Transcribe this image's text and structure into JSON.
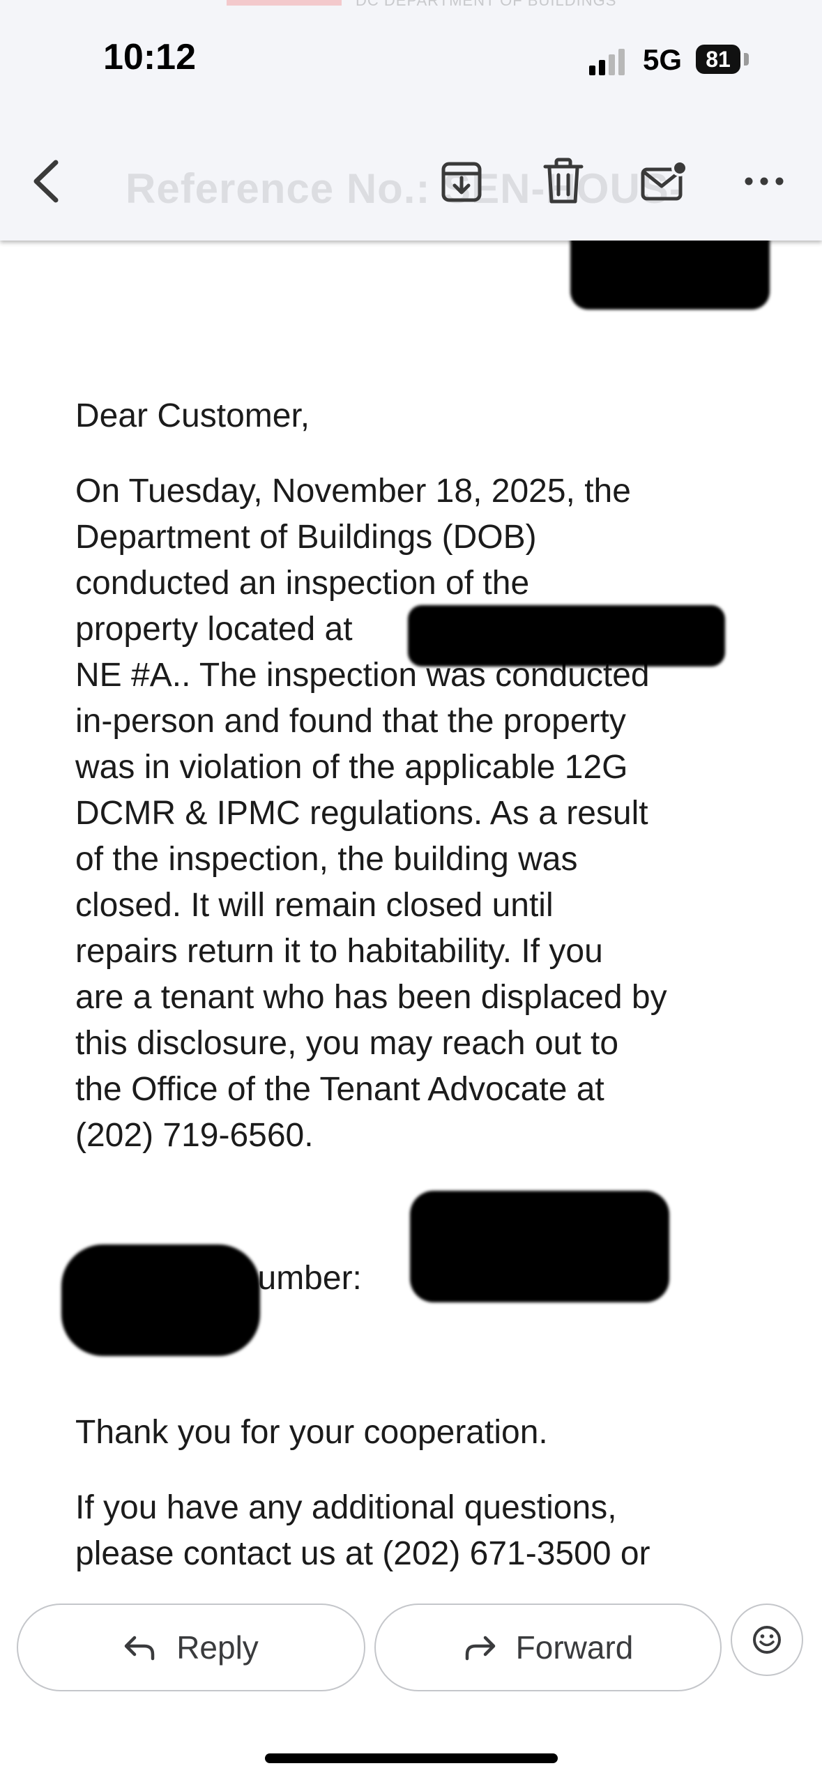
{
  "status_bar": {
    "time": "10:12",
    "network": "5G",
    "battery": "81"
  },
  "header": {
    "faint_sender_banner": "DC DEPARTMENT OF BUILDINGS",
    "faint_subject": "Reference No.: SEN-HOUS-",
    "icons": [
      "chevron-left-icon",
      "archive-icon",
      "trash-icon",
      "mark-unread-icon",
      "more-icon"
    ]
  },
  "email": {
    "greeting": "Dear Customer,",
    "body_lines": [
      "On Tuesday, November 18, 2025, the",
      "Department of Buildings (DOB)",
      "conducted an inspection of the",
      "property located at",
      "NE #A.. The inspection was conducted",
      "in-person and found that the property",
      "was in violation of the applicable 12G",
      "DCMR & IPMC regulations. As a result",
      "of the inspection, the building was",
      "closed. It will remain closed until",
      "repairs return it to habitability. If you",
      "are a tenant who has been displaced by",
      "this disclosure, you may reach out to",
      "the Office of the Tenant Advocate at",
      "(202) 719-6560."
    ],
    "reference_label": "Reference number:",
    "thanks": "Thank you for your cooperation.",
    "contact_lines": [
      "If you have any additional questions,",
      "please contact us at (202) 671-3500 or"
    ]
  },
  "actions": {
    "reply_label": "Reply",
    "forward_label": "Forward"
  },
  "colors": {
    "header_bg": "#f4f5f9",
    "text": "#1b1b1b",
    "button_border": "#c4c6ca"
  }
}
